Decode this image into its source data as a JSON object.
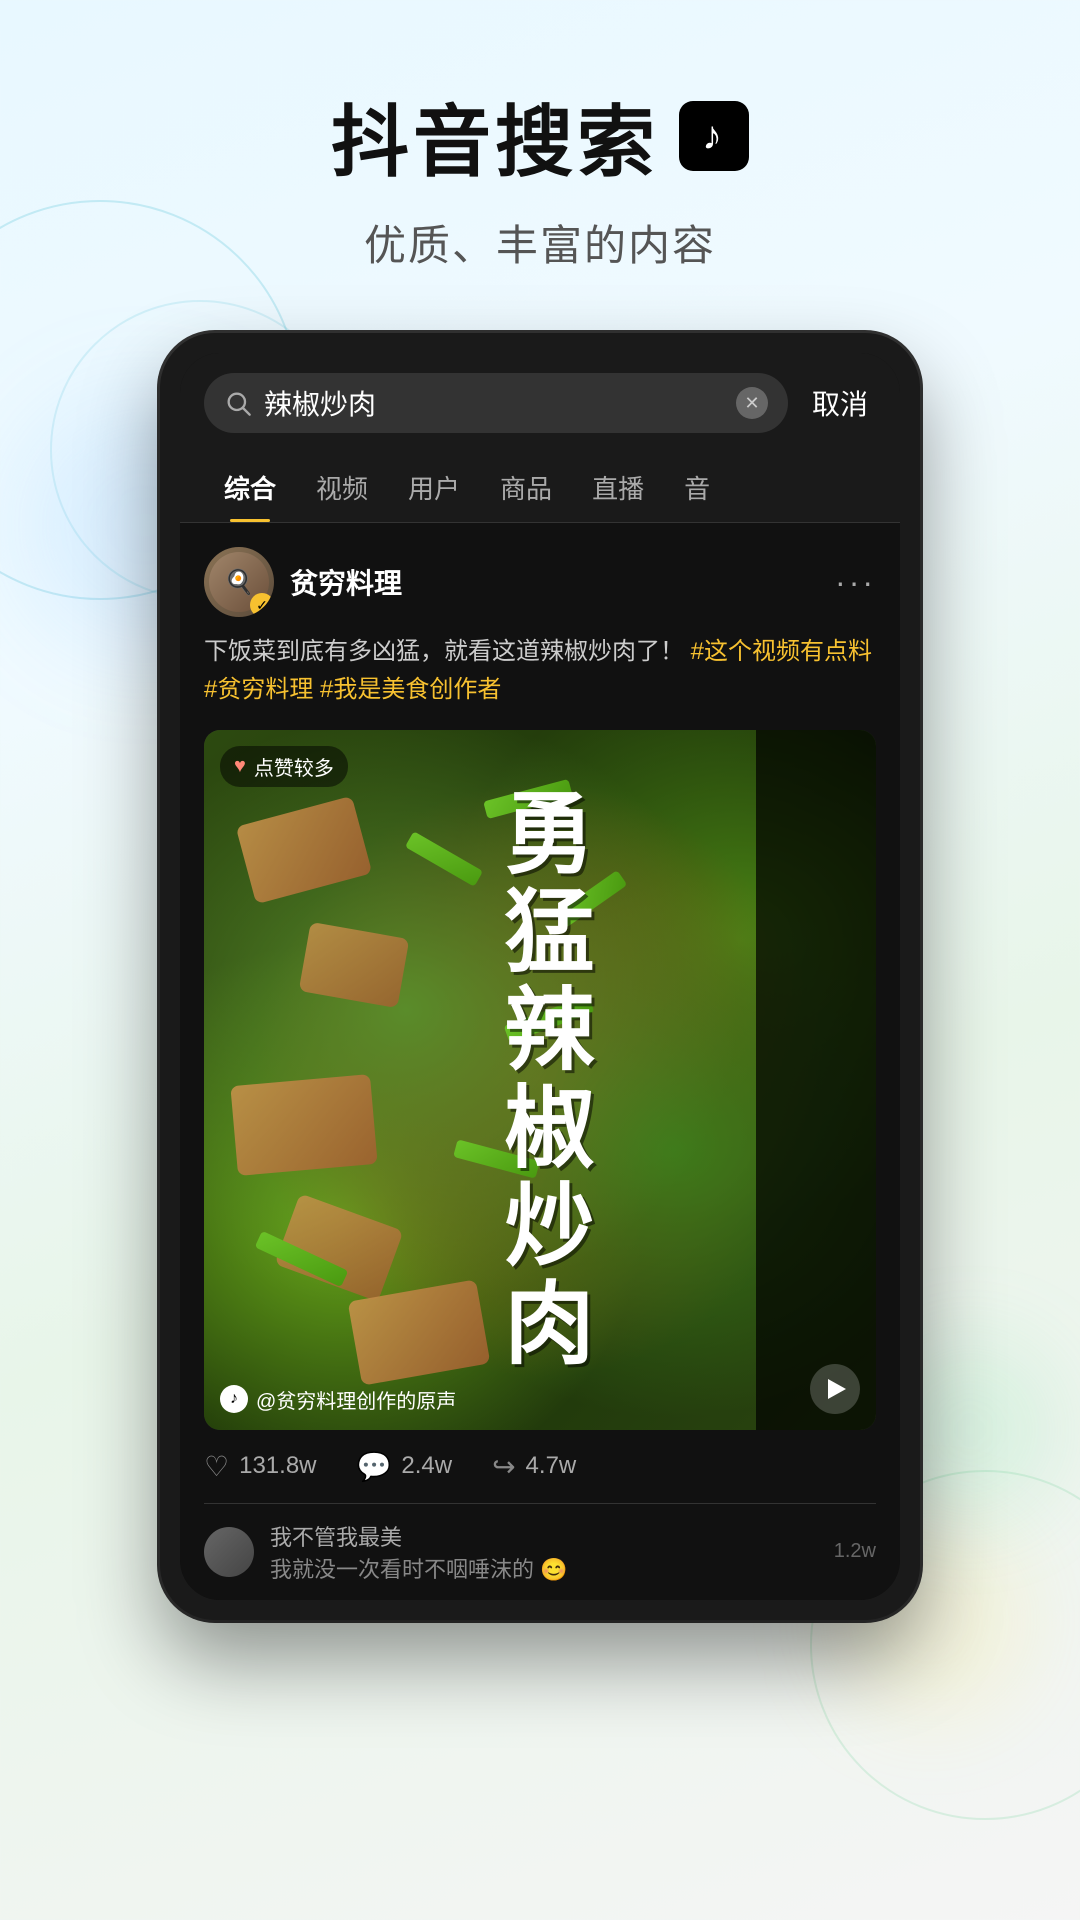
{
  "header": {
    "title": "抖音搜索",
    "tiktok_logo": "♪",
    "subtitle": "优质、丰富的内容"
  },
  "search": {
    "query": "辣椒炒肉",
    "cancel_label": "取消"
  },
  "tabs": [
    {
      "label": "综合",
      "active": true
    },
    {
      "label": "视频",
      "active": false
    },
    {
      "label": "用户",
      "active": false
    },
    {
      "label": "商品",
      "active": false
    },
    {
      "label": "直播",
      "active": false
    },
    {
      "label": "音",
      "active": false
    }
  ],
  "post": {
    "author_name": "贫穷料理",
    "verified": "✓",
    "text_plain": "下饭菜到底有多凶猛，就看这道辣椒炒肉了！",
    "hashtags": "#这个视频有点料 #贫穷料理 #我是美食创作者",
    "like_badge": "点赞较多",
    "video_title": "勇\n猛\n辣\n椒\n炒\n肉",
    "sound_text": "@贫穷料理创作的原声",
    "stats": {
      "likes": "131.8w",
      "comments": "2.4w",
      "shares": "4.7w"
    }
  },
  "comment": {
    "author": "我不管我最美",
    "text": "我就没一次看时不咽唾沫的 😊",
    "likes": "1.2w"
  },
  "colors": {
    "accent": "#f7c130",
    "bg_dark": "#111111",
    "tab_active": "#ffffff",
    "hashtag": "#f7c130"
  }
}
